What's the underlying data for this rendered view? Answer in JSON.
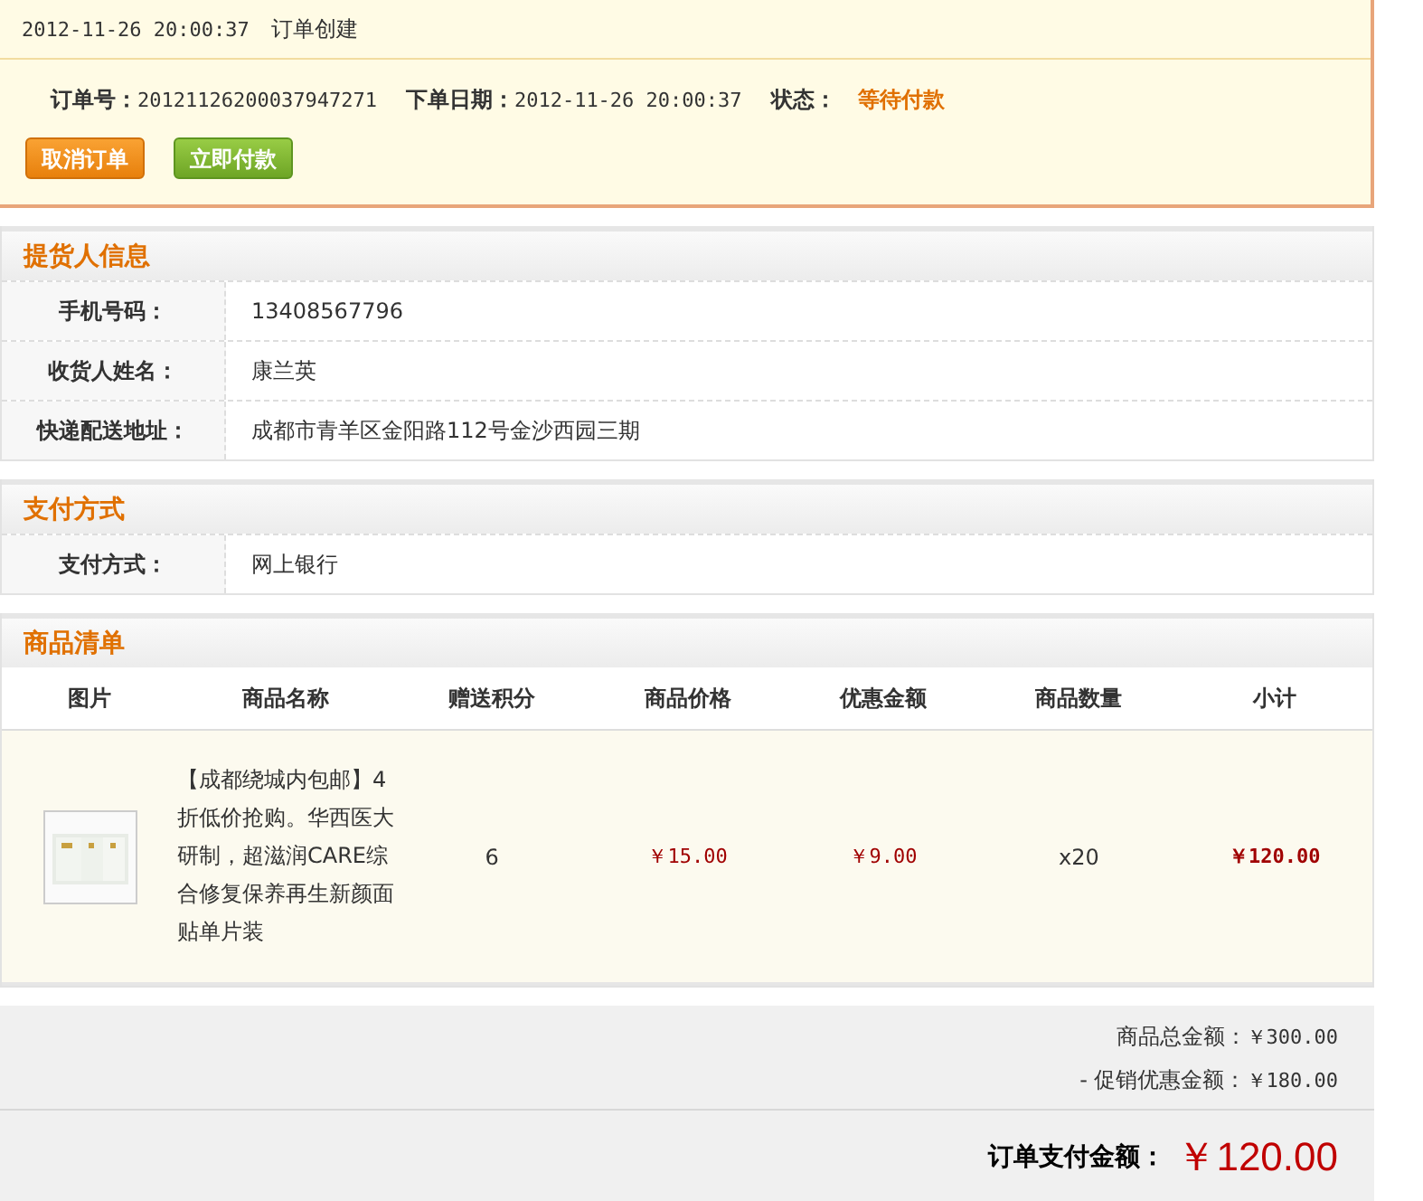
{
  "order_log": {
    "time": "2012-11-26 20:00:37",
    "event": "订单创建"
  },
  "order_info": {
    "fields": [
      {
        "label": "订单号：",
        "value": "20121126200037947271",
        "kind": "plain"
      },
      {
        "label": "下单日期：",
        "value": "2012-11-26 20:00:37",
        "kind": "plain"
      },
      {
        "label": "状态：",
        "value": "等待付款",
        "kind": "status"
      }
    ],
    "buttons": [
      {
        "label": "取消订单",
        "kind": "cancel"
      },
      {
        "label": "立即付款",
        "kind": "pay"
      }
    ]
  },
  "sections": [
    {
      "title": "提货人信息",
      "rows": [
        {
          "label": "手机号码：",
          "value": "13408567796"
        },
        {
          "label": "收货人姓名：",
          "value": "康兰英"
        },
        {
          "label": "快递配送地址：",
          "value": "成都市青羊区金阳路112号金沙西园三期"
        }
      ]
    },
    {
      "title": "支付方式",
      "rows": [
        {
          "label": "支付方式：",
          "value": "网上银行"
        }
      ]
    }
  ],
  "products": {
    "title": "商品清单",
    "columns": [
      "图片",
      "商品名称",
      "赠送积分",
      "商品价格",
      "优惠金额",
      "商品数量",
      "小计"
    ],
    "rows": [
      {
        "name": "【成都绕城内包邮】4折低价抢购。华西医大研制，超滋润CARE综合修复保养再生新颜面贴单片装",
        "points": "6",
        "price": "￥15.00",
        "discount": "￥9.00",
        "quantity": "x20",
        "subtotal": "￥120.00"
      }
    ]
  },
  "summary": {
    "lines": [
      {
        "label": "商品总金额：",
        "value": "￥300.00"
      },
      {
        "label": "- 促销优惠金额：",
        "value": "￥180.00"
      }
    ],
    "total": {
      "label": "订单支付金额：",
      "value": "￥120.00"
    }
  }
}
